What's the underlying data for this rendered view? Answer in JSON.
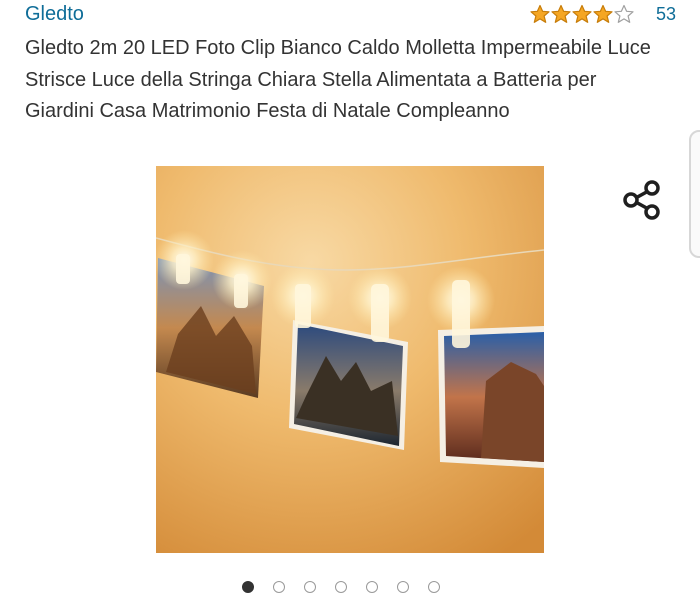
{
  "product": {
    "brand": "Gledto",
    "rating_value": 4,
    "rating_count": "53",
    "title": "Gledto 2m 20 LED Foto Clip Bianco Caldo Molletta Impermeabile Luce Strisce Luce della Stringa Chiara Stella Alimentata a Batteria per Giardini Casa Matrimonio Festa di Natale Compleanno"
  },
  "carousel": {
    "dot_count": 7,
    "active_index": 0
  },
  "icons": {
    "share": "share-icon",
    "star": "star-icon"
  },
  "colors": {
    "link": "#0f6d98",
    "star": "#f5a623",
    "text": "#333333"
  }
}
